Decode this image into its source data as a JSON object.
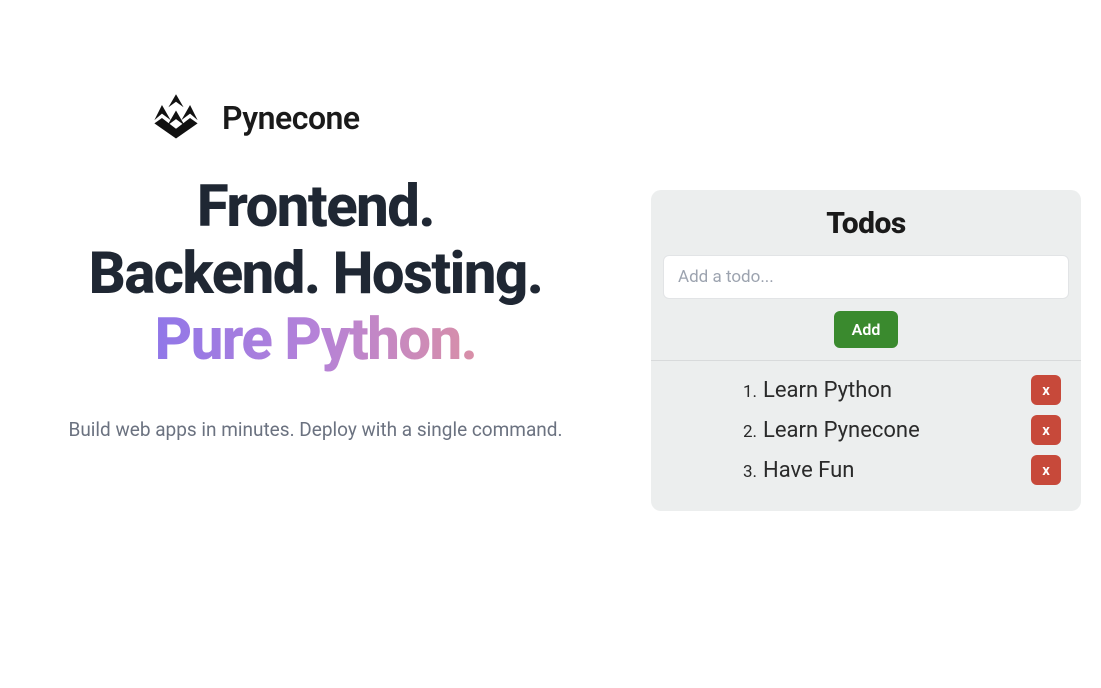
{
  "brand": {
    "name": "Pynecone"
  },
  "hero": {
    "line1": "Frontend.",
    "line2": "Backend. Hosting.",
    "line3": "Pure Python."
  },
  "subtitle": "Build web apps in minutes. Deploy with a single command.",
  "todo": {
    "title": "Todos",
    "input_placeholder": "Add a todo...",
    "input_value": "",
    "add_label": "Add",
    "delete_label": "x",
    "items": [
      {
        "num": "1.",
        "label": "Learn Python"
      },
      {
        "num": "2.",
        "label": "Learn Pynecone"
      },
      {
        "num": "3.",
        "label": "Have Fun"
      }
    ]
  }
}
